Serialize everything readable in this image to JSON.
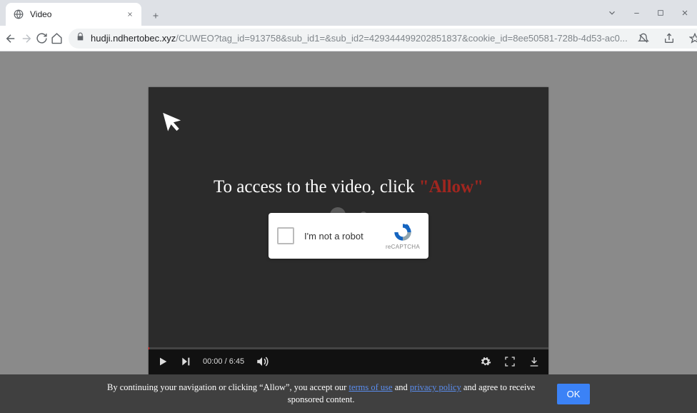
{
  "tab": {
    "title": "Video"
  },
  "url": {
    "host": "hudji.ndhertobec.xyz",
    "path": "/CUWEO?tag_id=913758&sub_id1=&sub_id2=4293444992028518​37&cookie_id=8ee50581-728b-4d53-ac0..."
  },
  "player": {
    "prompt_prefix": "To access to the video, click ",
    "prompt_allow": "\"Allow\"",
    "captcha_label": "I'm not a robot",
    "captcha_brand": "reCAPTCHA",
    "time_current": "00:00",
    "time_sep": " / ",
    "time_total": "6:45"
  },
  "consent": {
    "pre": "By continuing your navigation or clicking “Allow”, you accept our ",
    "terms": "terms of use",
    "mid": " and ",
    "privacy": "privacy policy",
    "post": " and agree to receive sponsored content.",
    "ok": "OK"
  }
}
